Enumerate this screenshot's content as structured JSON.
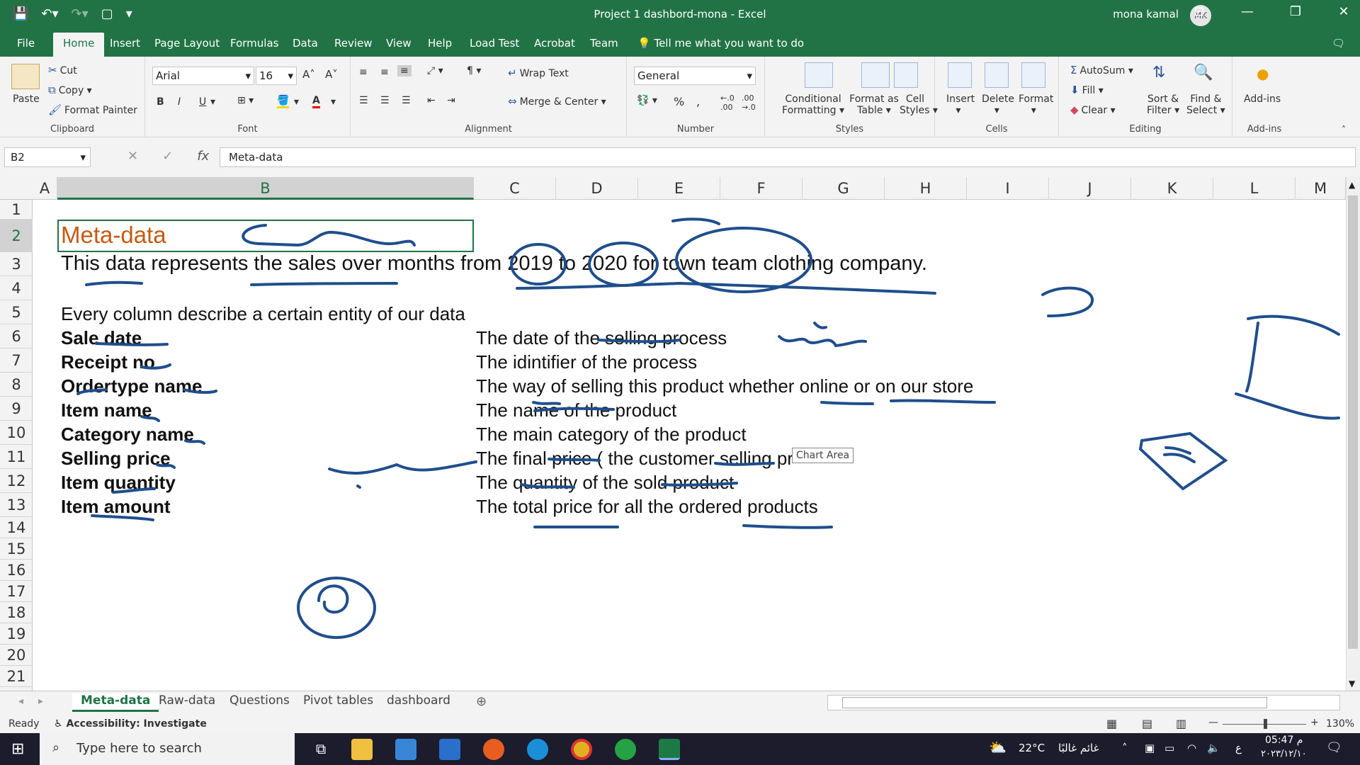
{
  "window": {
    "title": "Project 1 dashbord-mona  -  Excel",
    "user_name": "mona kamal",
    "user_initials": "MK",
    "controls": {
      "minimize": "—",
      "restore": "❐",
      "close": "✕"
    }
  },
  "ribbon_tabs": [
    "File",
    "Home",
    "Insert",
    "Page Layout",
    "Formulas",
    "Data",
    "Review",
    "View",
    "Help",
    "Load Test",
    "Acrobat",
    "Team"
  ],
  "tell_me": "Tell me what you want to do",
  "ribbon": {
    "clipboard": {
      "label": "Clipboard",
      "paste": "Paste",
      "cut": "Cut",
      "copy": "Copy",
      "format_painter": "Format Painter"
    },
    "font": {
      "label": "Font",
      "font_name": "Arial",
      "font_size": "16",
      "bold": "B",
      "italic": "I",
      "underline": "U"
    },
    "alignment": {
      "label": "Alignment",
      "wrap_text": "Wrap Text",
      "merge_center": "Merge & Center"
    },
    "number": {
      "label": "Number",
      "format": "General",
      "percent": "%"
    },
    "styles": {
      "label": "Styles",
      "conditional": "Conditional",
      "conditional2": "Formatting",
      "format_as": "Format as",
      "format_as2": "Table",
      "cell": "Cell",
      "cell2": "Styles"
    },
    "cells": {
      "label": "Cells",
      "insert": "Insert",
      "delete": "Delete",
      "format": "Format"
    },
    "editing": {
      "label": "Editing",
      "autosum": "AutoSum",
      "fill": "Fill",
      "clear": "Clear",
      "sort": "Sort &",
      "sort2": "Filter",
      "find": "Find &",
      "find2": "Select"
    },
    "addins": {
      "label": "Add-ins",
      "addins": "Add-ins"
    }
  },
  "formula_bar": {
    "name_box": "B2",
    "fx": "fx",
    "content": "Meta-data"
  },
  "columns": [
    "A",
    "B",
    "C",
    "D",
    "E",
    "F",
    "G",
    "H",
    "I",
    "J",
    "K",
    "L",
    "M"
  ],
  "rows": [
    "1",
    "2",
    "3",
    "4",
    "5",
    "6",
    "7",
    "8",
    "9",
    "10",
    "11",
    "12",
    "13",
    "14",
    "15",
    "16",
    "17",
    "18",
    "19",
    "20",
    "21"
  ],
  "cells": {
    "b2": "Meta-data",
    "b3": "This data represents the sales over months from 2019 to 2020 for town team clothing company.",
    "b5": "Every column describe a certain entity of our data",
    "fields": [
      {
        "name": "Sale date",
        "desc": "The date of the selling process"
      },
      {
        "name": "Receipt no",
        "desc": "The idintifier of the process"
      },
      {
        "name": "Ordertype name",
        "desc": "The way of selling this product whether online or on our store"
      },
      {
        "name": "Item name",
        "desc": "The name of the product"
      },
      {
        "name": "Category name",
        "desc": "The main category of the product"
      },
      {
        "name": "Selling price",
        "desc": "The final price ( the customer selling pr"
      },
      {
        "name": "Item quantity",
        "desc": "The quantity of the sold product"
      },
      {
        "name": "Item amount",
        "desc": "The total price for all the ordered products"
      }
    ]
  },
  "tooltip": "Chart Area",
  "sheet_tabs": [
    "Meta-data",
    "Raw-data",
    "Questions",
    "Pivot tables",
    "dashboard"
  ],
  "status": {
    "ready": "Ready",
    "accessibility": "Accessibility: Investigate",
    "zoom": "130%"
  },
  "taskbar": {
    "search": "Type here to search",
    "weather": "22°C",
    "weather_text": "غائم غالبًا",
    "time": "05:47 م",
    "date": "٢٠٢٣/١٢/١٠",
    "lang": "ع"
  },
  "colors": {
    "excel_green": "#217346",
    "title_orange": "#c55a11",
    "ink_blue": "#1f4e8c"
  }
}
